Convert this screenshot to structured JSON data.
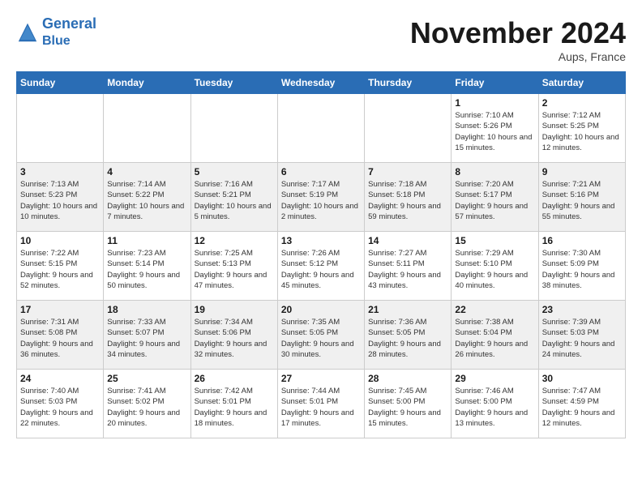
{
  "header": {
    "logo_line1": "General",
    "logo_line2": "Blue",
    "month": "November 2024",
    "location": "Aups, France"
  },
  "weekdays": [
    "Sunday",
    "Monday",
    "Tuesday",
    "Wednesday",
    "Thursday",
    "Friday",
    "Saturday"
  ],
  "weeks": [
    [
      {
        "day": "",
        "info": ""
      },
      {
        "day": "",
        "info": ""
      },
      {
        "day": "",
        "info": ""
      },
      {
        "day": "",
        "info": ""
      },
      {
        "day": "",
        "info": ""
      },
      {
        "day": "1",
        "info": "Sunrise: 7:10 AM\nSunset: 5:26 PM\nDaylight: 10 hours and 15 minutes."
      },
      {
        "day": "2",
        "info": "Sunrise: 7:12 AM\nSunset: 5:25 PM\nDaylight: 10 hours and 12 minutes."
      }
    ],
    [
      {
        "day": "3",
        "info": "Sunrise: 7:13 AM\nSunset: 5:23 PM\nDaylight: 10 hours and 10 minutes."
      },
      {
        "day": "4",
        "info": "Sunrise: 7:14 AM\nSunset: 5:22 PM\nDaylight: 10 hours and 7 minutes."
      },
      {
        "day": "5",
        "info": "Sunrise: 7:16 AM\nSunset: 5:21 PM\nDaylight: 10 hours and 5 minutes."
      },
      {
        "day": "6",
        "info": "Sunrise: 7:17 AM\nSunset: 5:19 PM\nDaylight: 10 hours and 2 minutes."
      },
      {
        "day": "7",
        "info": "Sunrise: 7:18 AM\nSunset: 5:18 PM\nDaylight: 9 hours and 59 minutes."
      },
      {
        "day": "8",
        "info": "Sunrise: 7:20 AM\nSunset: 5:17 PM\nDaylight: 9 hours and 57 minutes."
      },
      {
        "day": "9",
        "info": "Sunrise: 7:21 AM\nSunset: 5:16 PM\nDaylight: 9 hours and 55 minutes."
      }
    ],
    [
      {
        "day": "10",
        "info": "Sunrise: 7:22 AM\nSunset: 5:15 PM\nDaylight: 9 hours and 52 minutes."
      },
      {
        "day": "11",
        "info": "Sunrise: 7:23 AM\nSunset: 5:14 PM\nDaylight: 9 hours and 50 minutes."
      },
      {
        "day": "12",
        "info": "Sunrise: 7:25 AM\nSunset: 5:13 PM\nDaylight: 9 hours and 47 minutes."
      },
      {
        "day": "13",
        "info": "Sunrise: 7:26 AM\nSunset: 5:12 PM\nDaylight: 9 hours and 45 minutes."
      },
      {
        "day": "14",
        "info": "Sunrise: 7:27 AM\nSunset: 5:11 PM\nDaylight: 9 hours and 43 minutes."
      },
      {
        "day": "15",
        "info": "Sunrise: 7:29 AM\nSunset: 5:10 PM\nDaylight: 9 hours and 40 minutes."
      },
      {
        "day": "16",
        "info": "Sunrise: 7:30 AM\nSunset: 5:09 PM\nDaylight: 9 hours and 38 minutes."
      }
    ],
    [
      {
        "day": "17",
        "info": "Sunrise: 7:31 AM\nSunset: 5:08 PM\nDaylight: 9 hours and 36 minutes."
      },
      {
        "day": "18",
        "info": "Sunrise: 7:33 AM\nSunset: 5:07 PM\nDaylight: 9 hours and 34 minutes."
      },
      {
        "day": "19",
        "info": "Sunrise: 7:34 AM\nSunset: 5:06 PM\nDaylight: 9 hours and 32 minutes."
      },
      {
        "day": "20",
        "info": "Sunrise: 7:35 AM\nSunset: 5:05 PM\nDaylight: 9 hours and 30 minutes."
      },
      {
        "day": "21",
        "info": "Sunrise: 7:36 AM\nSunset: 5:05 PM\nDaylight: 9 hours and 28 minutes."
      },
      {
        "day": "22",
        "info": "Sunrise: 7:38 AM\nSunset: 5:04 PM\nDaylight: 9 hours and 26 minutes."
      },
      {
        "day": "23",
        "info": "Sunrise: 7:39 AM\nSunset: 5:03 PM\nDaylight: 9 hours and 24 minutes."
      }
    ],
    [
      {
        "day": "24",
        "info": "Sunrise: 7:40 AM\nSunset: 5:03 PM\nDaylight: 9 hours and 22 minutes."
      },
      {
        "day": "25",
        "info": "Sunrise: 7:41 AM\nSunset: 5:02 PM\nDaylight: 9 hours and 20 minutes."
      },
      {
        "day": "26",
        "info": "Sunrise: 7:42 AM\nSunset: 5:01 PM\nDaylight: 9 hours and 18 minutes."
      },
      {
        "day": "27",
        "info": "Sunrise: 7:44 AM\nSunset: 5:01 PM\nDaylight: 9 hours and 17 minutes."
      },
      {
        "day": "28",
        "info": "Sunrise: 7:45 AM\nSunset: 5:00 PM\nDaylight: 9 hours and 15 minutes."
      },
      {
        "day": "29",
        "info": "Sunrise: 7:46 AM\nSunset: 5:00 PM\nDaylight: 9 hours and 13 minutes."
      },
      {
        "day": "30",
        "info": "Sunrise: 7:47 AM\nSunset: 4:59 PM\nDaylight: 9 hours and 12 minutes."
      }
    ]
  ]
}
